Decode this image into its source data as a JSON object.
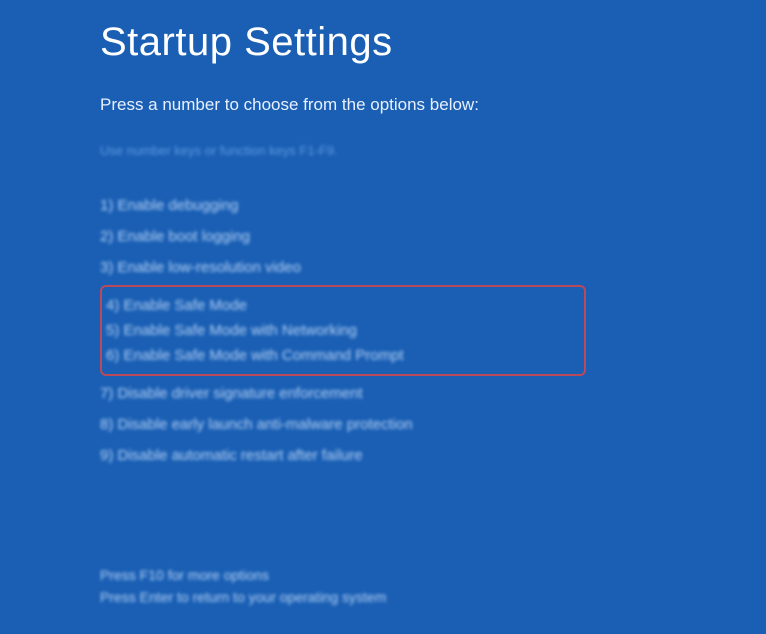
{
  "title": "Startup Settings",
  "subtitle": "Press a number to choose from the options below:",
  "hint": "Use number keys or function keys F1-F9.",
  "options": [
    {
      "label": "1) Enable debugging",
      "highlighted": false
    },
    {
      "label": "2) Enable boot logging",
      "highlighted": false
    },
    {
      "label": "3) Enable low-resolution video",
      "highlighted": false
    },
    {
      "label": "4) Enable Safe Mode",
      "highlighted": true
    },
    {
      "label": "5) Enable Safe Mode with Networking",
      "highlighted": true
    },
    {
      "label": "6) Enable Safe Mode with Command Prompt",
      "highlighted": true
    },
    {
      "label": "7) Disable driver signature enforcement",
      "highlighted": false
    },
    {
      "label": "8) Disable early launch anti-malware protection",
      "highlighted": false
    },
    {
      "label": "9) Disable automatic restart after failure",
      "highlighted": false
    }
  ],
  "footer": {
    "line1": "Press F10 for more options",
    "line2": "Press Enter to return to your operating system"
  }
}
